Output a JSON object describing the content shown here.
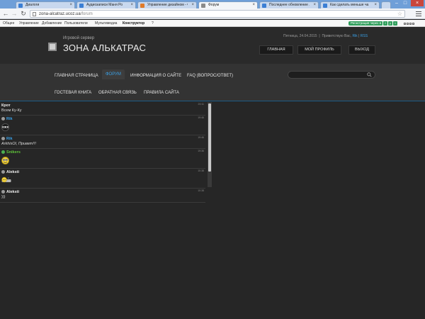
{
  "browser": {
    "tabs": [
      {
        "title": "Диалоги",
        "favicon_color": "#3b7fd4",
        "active": false
      },
      {
        "title": "Аудиозаписи Маня Ро",
        "favicon_color": "#3b7fd4",
        "active": false
      },
      {
        "title": "Управление дизайном - Ф",
        "favicon_color": "#e07b2a",
        "active": false
      },
      {
        "title": "Форум",
        "favicon_color": "#8a8a8a",
        "active": true
      },
      {
        "title": "Последнее обновление ...",
        "favicon_color": "#3b7fd4",
        "active": false
      },
      {
        "title": "Как сделать меньше ча",
        "favicon_color": "#3b7fd4",
        "active": false
      }
    ],
    "address": {
      "domain": "zona-alcatraz.ucoz.ua",
      "path": "/forum"
    }
  },
  "admin_bar": {
    "menu": [
      "Общее",
      "Управление",
      "Добавление",
      "Пользователи",
      "Мультимедиа",
      "Конструктор",
      "?"
    ],
    "register_label": "Регистрация через",
    "social": [
      "B",
      "f",
      "y",
      "t"
    ]
  },
  "site": {
    "subtitle": "Игровой сервер",
    "title": "ЗОНА АЛЬКАТРАС",
    "date": "Пятница, 24.04.2015",
    "greeting": "Приветствую Вас,",
    "username": "Rik",
    "rss": "RSS",
    "header_buttons": [
      "ГЛАВНАЯ",
      "МОЙ ПРОФИЛЬ",
      "ВЫХОД"
    ],
    "nav": {
      "row1": [
        "ГЛАВНАЯ СТРАНИЦА",
        "ФОРУМ",
        "ИНФОРМАЦИЯ О САЙТЕ",
        "FAQ (ВОПРОС/ОТВЕТ)"
      ],
      "row2": [
        "ГОСТЕВАЯ КНИГА",
        "ОБРАТНАЯ СВЯЗЬ",
        "ПРАВИЛА САЙТА"
      ],
      "active": "ФОРУМ"
    },
    "search_placeholder": ""
  },
  "chat": {
    "messages": [
      {
        "author": "Крот",
        "time": "20:11",
        "text": "Всем Ку-Ку",
        "smiley": "",
        "author_color": "white"
      },
      {
        "author": "Rik",
        "time": "19:46",
        "text": "",
        "smiley": "ninja",
        "author_color": "blue"
      },
      {
        "author": "Rik",
        "time": "19:46",
        "text": "ArkhisOl, Привет!!!",
        "smiley": "",
        "author_color": "blue"
      },
      {
        "author": "Snikers",
        "time": "19:36",
        "text": "",
        "smiley": "yellow",
        "author_color": "green"
      },
      {
        "author": "Aleksti",
        "time": "10:38",
        "text": "",
        "smiley": "sleep",
        "author_color": "white"
      },
      {
        "author": "Aleksti",
        "time": "10:38",
        "text": ")))",
        "smiley": "",
        "author_color": "white"
      }
    ]
  },
  "colors": {
    "accent": "#39a0e6",
    "bg": "#262626",
    "nav_bg": "#333333"
  }
}
